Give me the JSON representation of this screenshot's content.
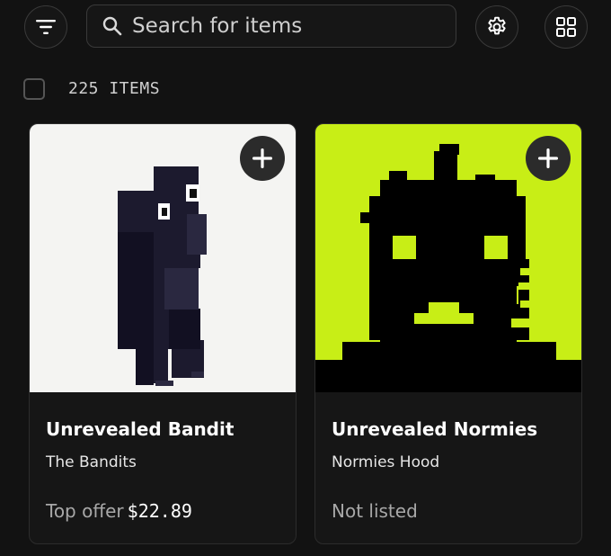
{
  "toolbar": {
    "filter_icon": "filter-icon",
    "settings_icon": "gear-icon",
    "view_icon": "grid-view-icon"
  },
  "search": {
    "placeholder": "Search for items",
    "value": "",
    "icon": "search-icon"
  },
  "results": {
    "count_label": "225 ITEMS"
  },
  "items": [
    {
      "title": "Unrevealed Bandit",
      "collection": "The Bandits",
      "price_label": "Top offer",
      "price_value": "$22.89",
      "image_bg": "#f4f4f2",
      "image_subject": "dark-voxel-frog-figure"
    },
    {
      "title": "Unrevealed Normies",
      "collection": "Normies Hood",
      "price_label": "Not listed",
      "price_value": "",
      "image_bg": "#c8ee16",
      "image_subject": "pixel-pumpkin-silhouette"
    }
  ],
  "colors": {
    "background": "#121212",
    "card": "#161616",
    "border": "#3a3a3a",
    "lime": "#c8ee16"
  }
}
